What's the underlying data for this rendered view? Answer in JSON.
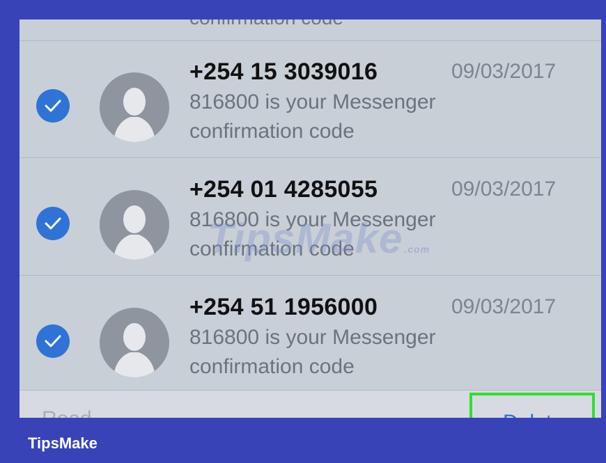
{
  "top_fragment": {
    "text": "confirmation code"
  },
  "messages": [
    {
      "sender": "+254 15 3039016",
      "date": "09/03/2017",
      "body": "816800 is your Messenger confirmation code",
      "selected": true
    },
    {
      "sender": "+254 01 4285055",
      "date": "09/03/2017",
      "body": "816800 is your Messenger confirmation code",
      "selected": true
    },
    {
      "sender": "+254 51 1956000",
      "date": "09/03/2017",
      "body": "816800 is your Messenger confirmation code",
      "selected": true
    }
  ],
  "toolbar": {
    "read_label": "Read",
    "delete_label": "Delete"
  },
  "watermark": {
    "text": "TipsMake",
    "suffix": ".com"
  },
  "footer": {
    "brand": "TipsMake"
  },
  "colors": {
    "checkbox": "#2f73d6",
    "highlight": "#2ee02e",
    "background_border": "#3843b8"
  }
}
